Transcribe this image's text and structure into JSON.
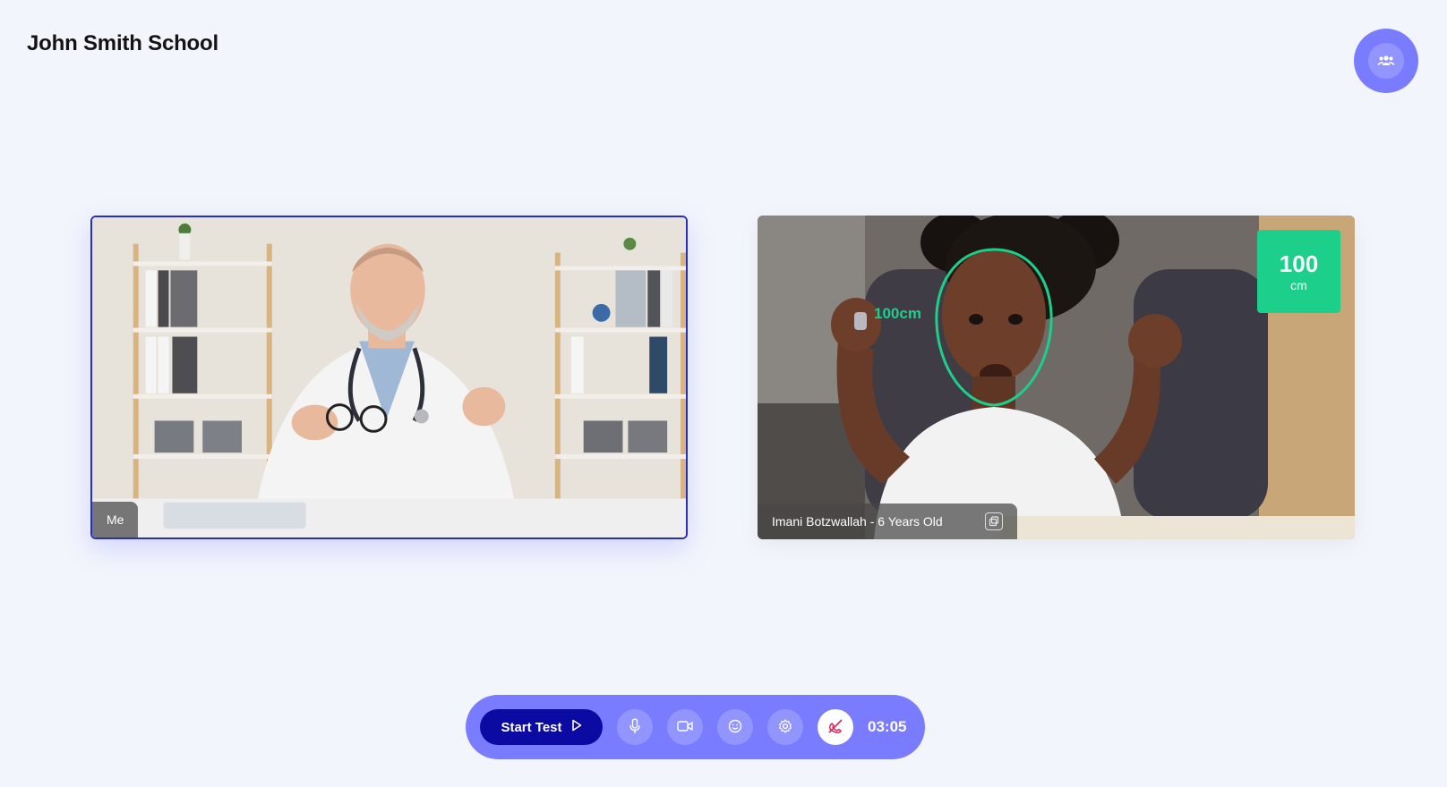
{
  "header": {
    "title": "John Smith School"
  },
  "participants_button": {
    "icon": "participants-icon"
  },
  "tiles": {
    "me": {
      "label": "Me"
    },
    "child": {
      "label": "Imani Botzwallah - 6 Years Old",
      "distance_value": "100",
      "distance_unit": "cm",
      "face_label": "100cm"
    }
  },
  "controls": {
    "start_label": "Start Test",
    "timer": "03:05",
    "buttons": [
      "mic-icon",
      "camera-icon",
      "emoji-icon",
      "settings-icon",
      "end-call-icon"
    ]
  },
  "colors": {
    "accent": "#7a7cff",
    "primary": "#0b0aa3",
    "success": "#1ccf8b",
    "background": "#f3f5fc",
    "danger": "#e0245e"
  }
}
